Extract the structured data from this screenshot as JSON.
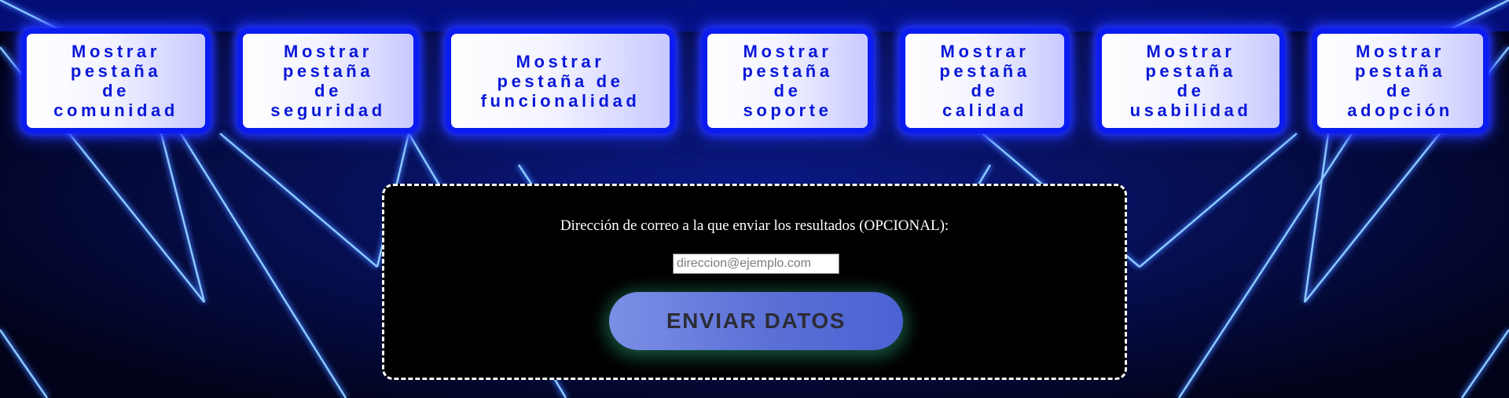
{
  "tabs": [
    {
      "label": "Mostrar\npestaña\nde\ncomunidad"
    },
    {
      "label": "Mostrar\npestaña\nde\nseguridad"
    },
    {
      "label": "Mostrar\npestaña de\nfuncionalidad"
    },
    {
      "label": "Mostrar\npestaña\nde\nsoporte"
    },
    {
      "label": "Mostrar\npestaña\nde\ncalidad"
    },
    {
      "label": "Mostrar\npestaña\nde\nusabilidad"
    },
    {
      "label": "Mostrar\npestaña\nde\nadopción"
    }
  ],
  "form": {
    "email_label": "Dirección de correo a la que enviar los resultados (OPCIONAL):",
    "email_value": "",
    "email_placeholder": "direccion@ejemplo.com",
    "submit_label": "ENVIAR DATOS"
  },
  "colors": {
    "background": "#05062a",
    "tab_border": "#0b1cf0",
    "tab_text": "#0a18d8",
    "laser": "#59a8ff",
    "button_glow": "#3ce6aa"
  }
}
